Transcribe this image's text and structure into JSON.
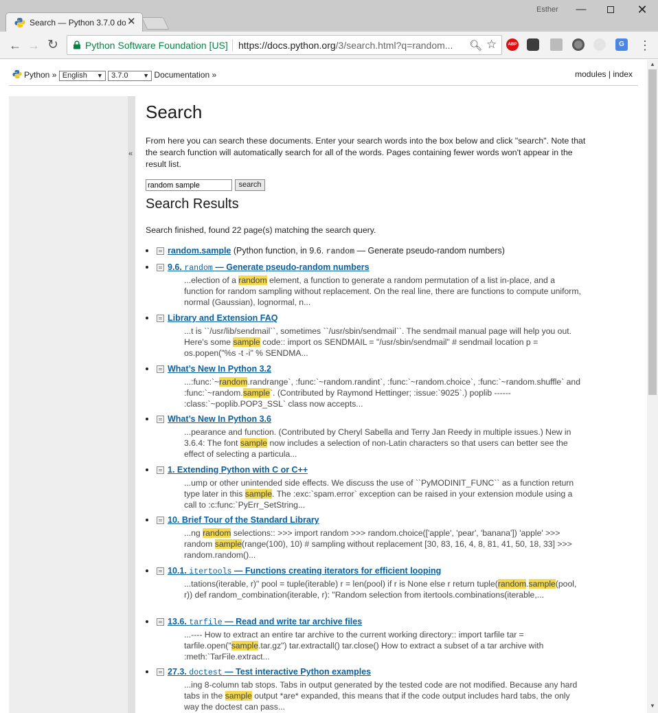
{
  "window": {
    "tab_title": "Search — Python 3.7.0 do",
    "user_name": "Esther",
    "minimize_glyph": "—",
    "close_glyph": "✕"
  },
  "toolbar": {
    "site_identity": "Python Software Foundation [US]",
    "url_main": "https://docs.python.org",
    "url_rest": "/3/search.html?q=random...",
    "abp_label": "ABP",
    "translate_label": "G"
  },
  "related": {
    "python_label": "Python",
    "sep": "»",
    "language_selected": "English",
    "version_selected": "3.7.0",
    "documentation_label": "Documentation",
    "modules_label": "modules",
    "pipe": "|",
    "index_label": "index"
  },
  "sidebar": {
    "collapse_glyph": "«"
  },
  "main": {
    "title": "Search",
    "intro": "From here you can search these documents. Enter your search words into the box below and click \"search\". Note that the search function will automatically search for all of the words. Pages containing fewer words won't appear in the result list.",
    "search_value": "random sample",
    "search_button": "search",
    "results_title": "Search Results",
    "summary": "Search finished, found 22 page(s) matching the search query."
  },
  "results": [
    {
      "title": "random.sample",
      "context_prefix": "(Python function, in 9.6. ",
      "context_code": "random",
      "context_suffix": " — Generate pseudo-random numbers)"
    },
    {
      "title_num": "9.6.",
      "title_code": "random",
      "title_text": "— Generate pseudo-random numbers",
      "snippet": "...election of a [[random]] element, a function to generate a random permutation of a list in-place, and a function for random sampling without replacement. On the real line, there are functions to compute uniform, normal (Gaussian), lognormal, n..."
    },
    {
      "title_text": "Library and Extension FAQ",
      "snippet": "...t is ``/usr/lib/sendmail``, sometimes ``/usr/sbin/sendmail``. The sendmail manual page will help you out. Here's some [[sample]] code:: import os SENDMAIL = \"/usr/sbin/sendmail\" # sendmail location p = os.popen(\"%s -t -i\" % SENDMA..."
    },
    {
      "title_text": "What’s New In Python 3.2",
      "snippet": "...:func:`~[[random]].randrange`, :func:`~random.randint`, :func:`~random.choice`, :func:`~random.shuffle` and :func:`~random.[[sample]]`. (Contributed by Raymond Hettinger; :issue:`9025`.) poplib ------ :class:`~poplib.POP3_SSL` class now accepts..."
    },
    {
      "title_text": "What’s New In Python 3.6",
      "snippet": "...pearance and function. (Contributed by Cheryl Sabella and Terry Jan Reedy in multiple issues.) New in 3.6.4: The font [[sample]] now includes a selection of non-Latin characters so that users can better see the effect of selecting a particula..."
    },
    {
      "title_text": "1. Extending Python with C or C++",
      "snippet": "...ump or other unintended side effects. We discuss the use of ``PyMODINIT_FUNC`` as a function return type later in this [[sample]]. The :exc:`spam.error` exception can be raised in your extension module using a call to :c:func:`PyErr_SetString..."
    },
    {
      "title_text": "10. Brief Tour of the Standard Library",
      "snippet": "...ng [[random]] selections:: >>> import random >>> random.choice(['apple', 'pear', 'banana']) 'apple' >>> random [[sample]](range(100), 10) # sampling without replacement [30, 83, 16, 4, 8, 81, 41, 50, 18, 33] >>> random.random()..."
    },
    {
      "title_num": "10.1.",
      "title_code": "itertools",
      "title_text": "— Functions creating iterators for efficient looping",
      "snippet": "...tations(iterable, r)\" pool = tuple(iterable) r = len(pool) if r is None else r return tuple([[random]].[[sample]](pool, r)) def random_combination(iterable, r): \"Random selection from itertools.combinations(iterable,..."
    },
    {
      "title_num": "13.6.",
      "title_code": "tarfile",
      "title_text": "— Read and write tar archive files",
      "snippet": "...---- How to extract an entire tar archive to the current working directory:: import tarfile tar = tarfile.open(\"[[sample]].tar.gz\") tar.extractall() tar.close() How to extract a subset of a tar archive with :meth:`TarFile.extract..."
    },
    {
      "title_num": "27.3.",
      "title_code": "doctest",
      "title_text": "— Test interactive Python examples",
      "snippet": "...ing 8-column tab stops. Tabs in output generated by the tested code are not modified. Because any hard tabs in the [[sample]] output *are* expanded, this means that if the code output includes hard tabs, the only way the doctest can pass..."
    }
  ],
  "colors": {
    "link": "#0a5f9e",
    "highlight": "#f2d94f",
    "secure_green": "#0b8043"
  }
}
